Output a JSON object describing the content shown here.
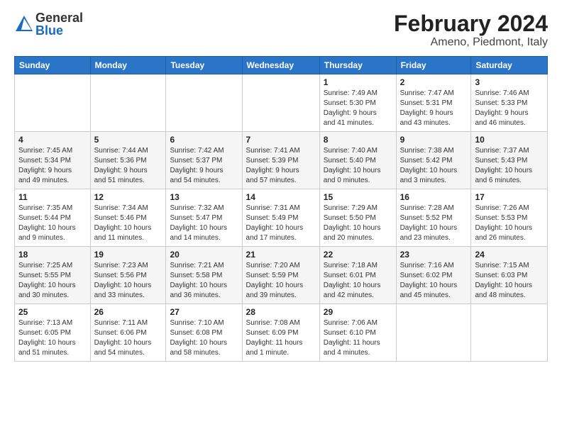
{
  "logo": {
    "general": "General",
    "blue": "Blue"
  },
  "title": "February 2024",
  "subtitle": "Ameno, Piedmont, Italy",
  "days_header": [
    "Sunday",
    "Monday",
    "Tuesday",
    "Wednesday",
    "Thursday",
    "Friday",
    "Saturday"
  ],
  "weeks": [
    [
      {
        "num": "",
        "info": ""
      },
      {
        "num": "",
        "info": ""
      },
      {
        "num": "",
        "info": ""
      },
      {
        "num": "",
        "info": ""
      },
      {
        "num": "1",
        "info": "Sunrise: 7:49 AM\nSunset: 5:30 PM\nDaylight: 9 hours\nand 41 minutes."
      },
      {
        "num": "2",
        "info": "Sunrise: 7:47 AM\nSunset: 5:31 PM\nDaylight: 9 hours\nand 43 minutes."
      },
      {
        "num": "3",
        "info": "Sunrise: 7:46 AM\nSunset: 5:33 PM\nDaylight: 9 hours\nand 46 minutes."
      }
    ],
    [
      {
        "num": "4",
        "info": "Sunrise: 7:45 AM\nSunset: 5:34 PM\nDaylight: 9 hours\nand 49 minutes."
      },
      {
        "num": "5",
        "info": "Sunrise: 7:44 AM\nSunset: 5:36 PM\nDaylight: 9 hours\nand 51 minutes."
      },
      {
        "num": "6",
        "info": "Sunrise: 7:42 AM\nSunset: 5:37 PM\nDaylight: 9 hours\nand 54 minutes."
      },
      {
        "num": "7",
        "info": "Sunrise: 7:41 AM\nSunset: 5:39 PM\nDaylight: 9 hours\nand 57 minutes."
      },
      {
        "num": "8",
        "info": "Sunrise: 7:40 AM\nSunset: 5:40 PM\nDaylight: 10 hours\nand 0 minutes."
      },
      {
        "num": "9",
        "info": "Sunrise: 7:38 AM\nSunset: 5:42 PM\nDaylight: 10 hours\nand 3 minutes."
      },
      {
        "num": "10",
        "info": "Sunrise: 7:37 AM\nSunset: 5:43 PM\nDaylight: 10 hours\nand 6 minutes."
      }
    ],
    [
      {
        "num": "11",
        "info": "Sunrise: 7:35 AM\nSunset: 5:44 PM\nDaylight: 10 hours\nand 9 minutes."
      },
      {
        "num": "12",
        "info": "Sunrise: 7:34 AM\nSunset: 5:46 PM\nDaylight: 10 hours\nand 11 minutes."
      },
      {
        "num": "13",
        "info": "Sunrise: 7:32 AM\nSunset: 5:47 PM\nDaylight: 10 hours\nand 14 minutes."
      },
      {
        "num": "14",
        "info": "Sunrise: 7:31 AM\nSunset: 5:49 PM\nDaylight: 10 hours\nand 17 minutes."
      },
      {
        "num": "15",
        "info": "Sunrise: 7:29 AM\nSunset: 5:50 PM\nDaylight: 10 hours\nand 20 minutes."
      },
      {
        "num": "16",
        "info": "Sunrise: 7:28 AM\nSunset: 5:52 PM\nDaylight: 10 hours\nand 23 minutes."
      },
      {
        "num": "17",
        "info": "Sunrise: 7:26 AM\nSunset: 5:53 PM\nDaylight: 10 hours\nand 26 minutes."
      }
    ],
    [
      {
        "num": "18",
        "info": "Sunrise: 7:25 AM\nSunset: 5:55 PM\nDaylight: 10 hours\nand 30 minutes."
      },
      {
        "num": "19",
        "info": "Sunrise: 7:23 AM\nSunset: 5:56 PM\nDaylight: 10 hours\nand 33 minutes."
      },
      {
        "num": "20",
        "info": "Sunrise: 7:21 AM\nSunset: 5:58 PM\nDaylight: 10 hours\nand 36 minutes."
      },
      {
        "num": "21",
        "info": "Sunrise: 7:20 AM\nSunset: 5:59 PM\nDaylight: 10 hours\nand 39 minutes."
      },
      {
        "num": "22",
        "info": "Sunrise: 7:18 AM\nSunset: 6:01 PM\nDaylight: 10 hours\nand 42 minutes."
      },
      {
        "num": "23",
        "info": "Sunrise: 7:16 AM\nSunset: 6:02 PM\nDaylight: 10 hours\nand 45 minutes."
      },
      {
        "num": "24",
        "info": "Sunrise: 7:15 AM\nSunset: 6:03 PM\nDaylight: 10 hours\nand 48 minutes."
      }
    ],
    [
      {
        "num": "25",
        "info": "Sunrise: 7:13 AM\nSunset: 6:05 PM\nDaylight: 10 hours\nand 51 minutes."
      },
      {
        "num": "26",
        "info": "Sunrise: 7:11 AM\nSunset: 6:06 PM\nDaylight: 10 hours\nand 54 minutes."
      },
      {
        "num": "27",
        "info": "Sunrise: 7:10 AM\nSunset: 6:08 PM\nDaylight: 10 hours\nand 58 minutes."
      },
      {
        "num": "28",
        "info": "Sunrise: 7:08 AM\nSunset: 6:09 PM\nDaylight: 11 hours\nand 1 minute."
      },
      {
        "num": "29",
        "info": "Sunrise: 7:06 AM\nSunset: 6:10 PM\nDaylight: 11 hours\nand 4 minutes."
      },
      {
        "num": "",
        "info": ""
      },
      {
        "num": "",
        "info": ""
      }
    ]
  ]
}
